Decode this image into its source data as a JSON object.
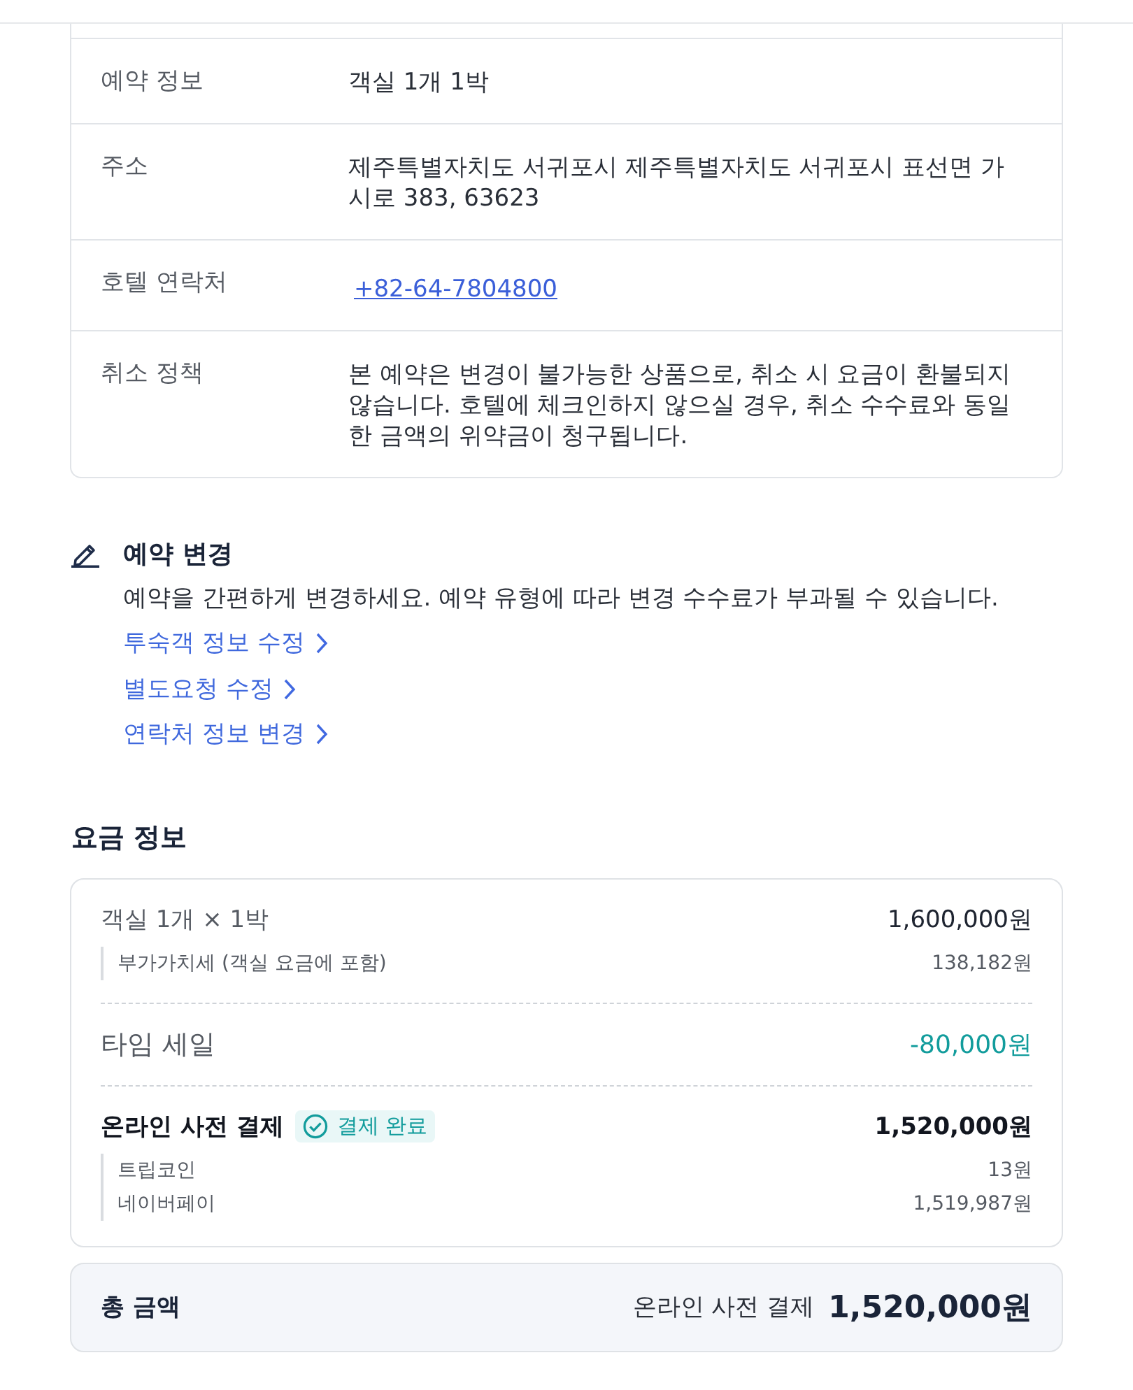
{
  "booking_details": {
    "rows": [
      {
        "label": "예약 정보",
        "value": "객실 1개 1박",
        "kind": "text"
      },
      {
        "label": "주소",
        "value": "제주특별자치도 서귀포시 제주특별자치도 서귀포시 표선면 가시로 383, 63623",
        "kind": "text"
      },
      {
        "label": "호텔 연락처",
        "value": "+82-64-7804800",
        "kind": "link"
      },
      {
        "label": "취소 정책",
        "value": "본 예약은 변경이 불가능한 상품으로, 취소 시 요금이 환불되지 않습니다. 호텔에 체크인하지 않으실 경우, 취소 수수료와 동일한 금액의 위약금이 청구됩니다.",
        "kind": "text"
      }
    ]
  },
  "modify_booking": {
    "title": "예약 변경",
    "description": "예약을 간편하게 변경하세요. 예약 유형에 따라 변경 수수료가 부과될 수 있습니다.",
    "links": [
      "투숙객 정보 수정",
      "별도요청 수정",
      "연락처 정보 변경"
    ]
  },
  "price_info": {
    "title": "요금 정보",
    "groups": [
      {
        "label": "객실 1개 × 1박",
        "amount": "1,600,000원",
        "kind": "charge",
        "details": [
          {
            "label": "부가가치세 (객실 요금에 포함)",
            "amount": "138,182원"
          }
        ]
      },
      {
        "label": "타임 세일",
        "amount": "-80,000원",
        "kind": "discount"
      },
      {
        "label": "온라인 사전 결제",
        "amount": "1,520,000원",
        "kind": "payment",
        "badge": "결제 완료",
        "details": [
          {
            "label": "트립코인",
            "amount": "13원"
          },
          {
            "label": "네이버페이",
            "amount": "1,519,987원"
          }
        ]
      }
    ]
  },
  "total": {
    "label": "총 금액",
    "method": "온라인 사전 결제",
    "amount": "1,520,000원"
  }
}
